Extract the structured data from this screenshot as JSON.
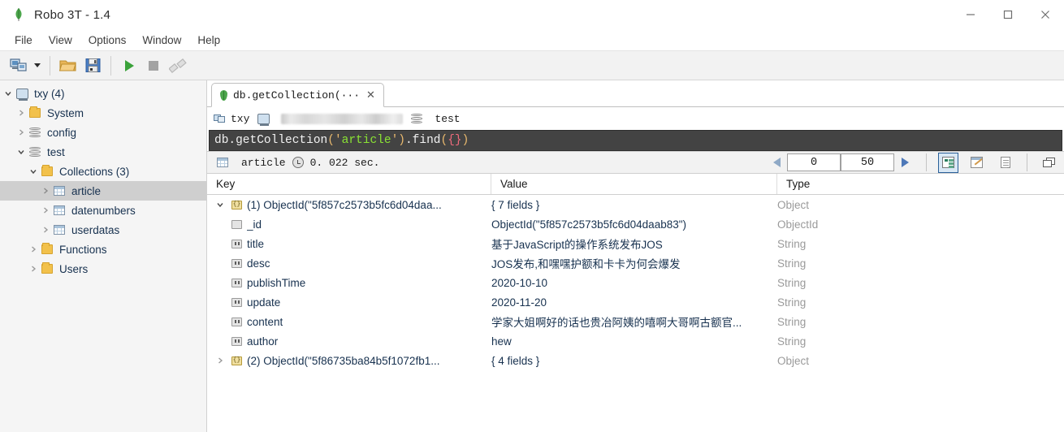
{
  "window": {
    "title": "Robo 3T - 1.4",
    "app_icon": "mongodb-leaf-icon",
    "controls": {
      "minimize": "minimize-icon",
      "maximize": "maximize-icon",
      "close": "close-icon"
    }
  },
  "menubar": {
    "items": [
      {
        "label": "File"
      },
      {
        "label": "View"
      },
      {
        "label": "Options"
      },
      {
        "label": "Window"
      },
      {
        "label": "Help"
      }
    ]
  },
  "toolbar": {
    "buttons": [
      {
        "name": "connect-button",
        "icon": "connect-icon"
      },
      {
        "name": "connect-dropdown",
        "icon": "caret-down-icon"
      },
      {
        "name": "open-script-button",
        "icon": "folder-open-icon"
      },
      {
        "name": "save-script-button",
        "icon": "floppy-save-icon"
      },
      {
        "name": "execute-button",
        "icon": "play-icon"
      },
      {
        "name": "stop-button",
        "icon": "stop-square-icon"
      },
      {
        "name": "disconnect-button",
        "icon": "broken-link-icon"
      }
    ]
  },
  "sidebar": {
    "items": [
      {
        "label": "txy (4)",
        "icon": "server-icon",
        "indent": 0,
        "twisty": "down",
        "selected": false
      },
      {
        "label": "System",
        "icon": "folder-icon",
        "indent": 1,
        "twisty": "right",
        "selected": false
      },
      {
        "label": "config",
        "icon": "database-icon",
        "indent": 1,
        "twisty": "right",
        "selected": false
      },
      {
        "label": "test",
        "icon": "database-icon",
        "indent": 1,
        "twisty": "down",
        "selected": false
      },
      {
        "label": "Collections (3)",
        "icon": "folder-icon",
        "indent": 2,
        "twisty": "down",
        "selected": false
      },
      {
        "label": "article",
        "icon": "collection-icon",
        "indent": 3,
        "twisty": "right",
        "selected": true
      },
      {
        "label": "datenumbers",
        "icon": "collection-icon",
        "indent": 3,
        "twisty": "right",
        "selected": false
      },
      {
        "label": "userdatas",
        "icon": "collection-icon",
        "indent": 3,
        "twisty": "right",
        "selected": false
      },
      {
        "label": "Functions",
        "icon": "folder-icon",
        "indent": 2,
        "twisty": "right",
        "selected": false
      },
      {
        "label": "Users",
        "icon": "folder-icon",
        "indent": 2,
        "twisty": "right",
        "selected": false
      }
    ]
  },
  "tab": {
    "label": "db.getCollection(···",
    "icon": "mongodb-leaf-icon",
    "close": "✕"
  },
  "connection_bar": {
    "connection_name": "txy",
    "host": "",
    "host_redacted": true,
    "database": "test"
  },
  "query": {
    "tokens": [
      {
        "text": "db.getCollection",
        "type": "plain"
      },
      {
        "text": "(",
        "type": "punc"
      },
      {
        "text": "'",
        "type": "punc"
      },
      {
        "text": "article",
        "type": "str"
      },
      {
        "text": "'",
        "type": "punc"
      },
      {
        "text": ")",
        "type": "punc"
      },
      {
        "text": ".find",
        "type": "plain"
      },
      {
        "text": "(",
        "type": "punc"
      },
      {
        "text": "{}",
        "type": "brace"
      },
      {
        "text": ")",
        "type": "punc"
      }
    ],
    "full_text": "db.getCollection('article').find({})"
  },
  "result_bar": {
    "collection": "article",
    "duration": "0. 022 sec.",
    "skip": "0",
    "limit": "50",
    "prev_enabled": false,
    "next_enabled": true,
    "view_modes": [
      {
        "name": "tree-view-button",
        "icon": "tree-view-icon",
        "active": true
      },
      {
        "name": "table-view-button",
        "icon": "table-view-icon",
        "active": false
      },
      {
        "name": "text-view-button",
        "icon": "text-view-icon",
        "active": false
      }
    ],
    "maximize_output": {
      "name": "maximize-output-button",
      "icon": "window-restore-icon"
    }
  },
  "grid": {
    "headers": {
      "key": "Key",
      "value": "Value",
      "type": "Type"
    },
    "rows": [
      {
        "key": "(1) ObjectId(\"5f857c2573b5fc6d04daa...",
        "value": "{ 7 fields }",
        "type": "Object",
        "icon": "object-icon",
        "indent": 0,
        "twisty": "down"
      },
      {
        "key": "_id",
        "value": "ObjectId(\"5f857c2573b5fc6d04daab83\")",
        "type": "ObjectId",
        "icon": "plain-field-icon",
        "indent": 1,
        "twisty": "none"
      },
      {
        "key": "title",
        "value": "基于JavaScript的操作系统发布JOS",
        "type": "String",
        "icon": "string-field-icon",
        "indent": 1,
        "twisty": "none"
      },
      {
        "key": "desc",
        "value": "JOS发布,和嘿嘿护额和卡卡为何会爆发",
        "type": "String",
        "icon": "string-field-icon",
        "indent": 1,
        "twisty": "none"
      },
      {
        "key": "publishTime",
        "value": "2020-10-10",
        "type": "String",
        "icon": "string-field-icon",
        "indent": 1,
        "twisty": "none"
      },
      {
        "key": "update",
        "value": "2020-11-20",
        "type": "String",
        "icon": "string-field-icon",
        "indent": 1,
        "twisty": "none"
      },
      {
        "key": "content",
        "value": "学家大姐啊好的话也贵冶阿姨的嘻啊大哥啊古额官...",
        "type": "String",
        "icon": "string-field-icon",
        "indent": 1,
        "twisty": "none"
      },
      {
        "key": "author",
        "value": "hew",
        "type": "String",
        "icon": "string-field-icon",
        "indent": 1,
        "twisty": "none"
      },
      {
        "key": "(2) ObjectId(\"5f86735ba84b5f1072fb1...",
        "value": "{ 4 fields }",
        "type": "Object",
        "icon": "object-icon",
        "indent": 0,
        "twisty": "right"
      }
    ]
  },
  "colors": {
    "accent": "#2a6099",
    "toolbar_bg": "#f2f2f2",
    "sidebar_bg": "#f5f5f5",
    "editor_bg": "#434343",
    "selection": "#cfcfcf",
    "value_text": "#17314f",
    "type_text": "#9a9a9a"
  }
}
